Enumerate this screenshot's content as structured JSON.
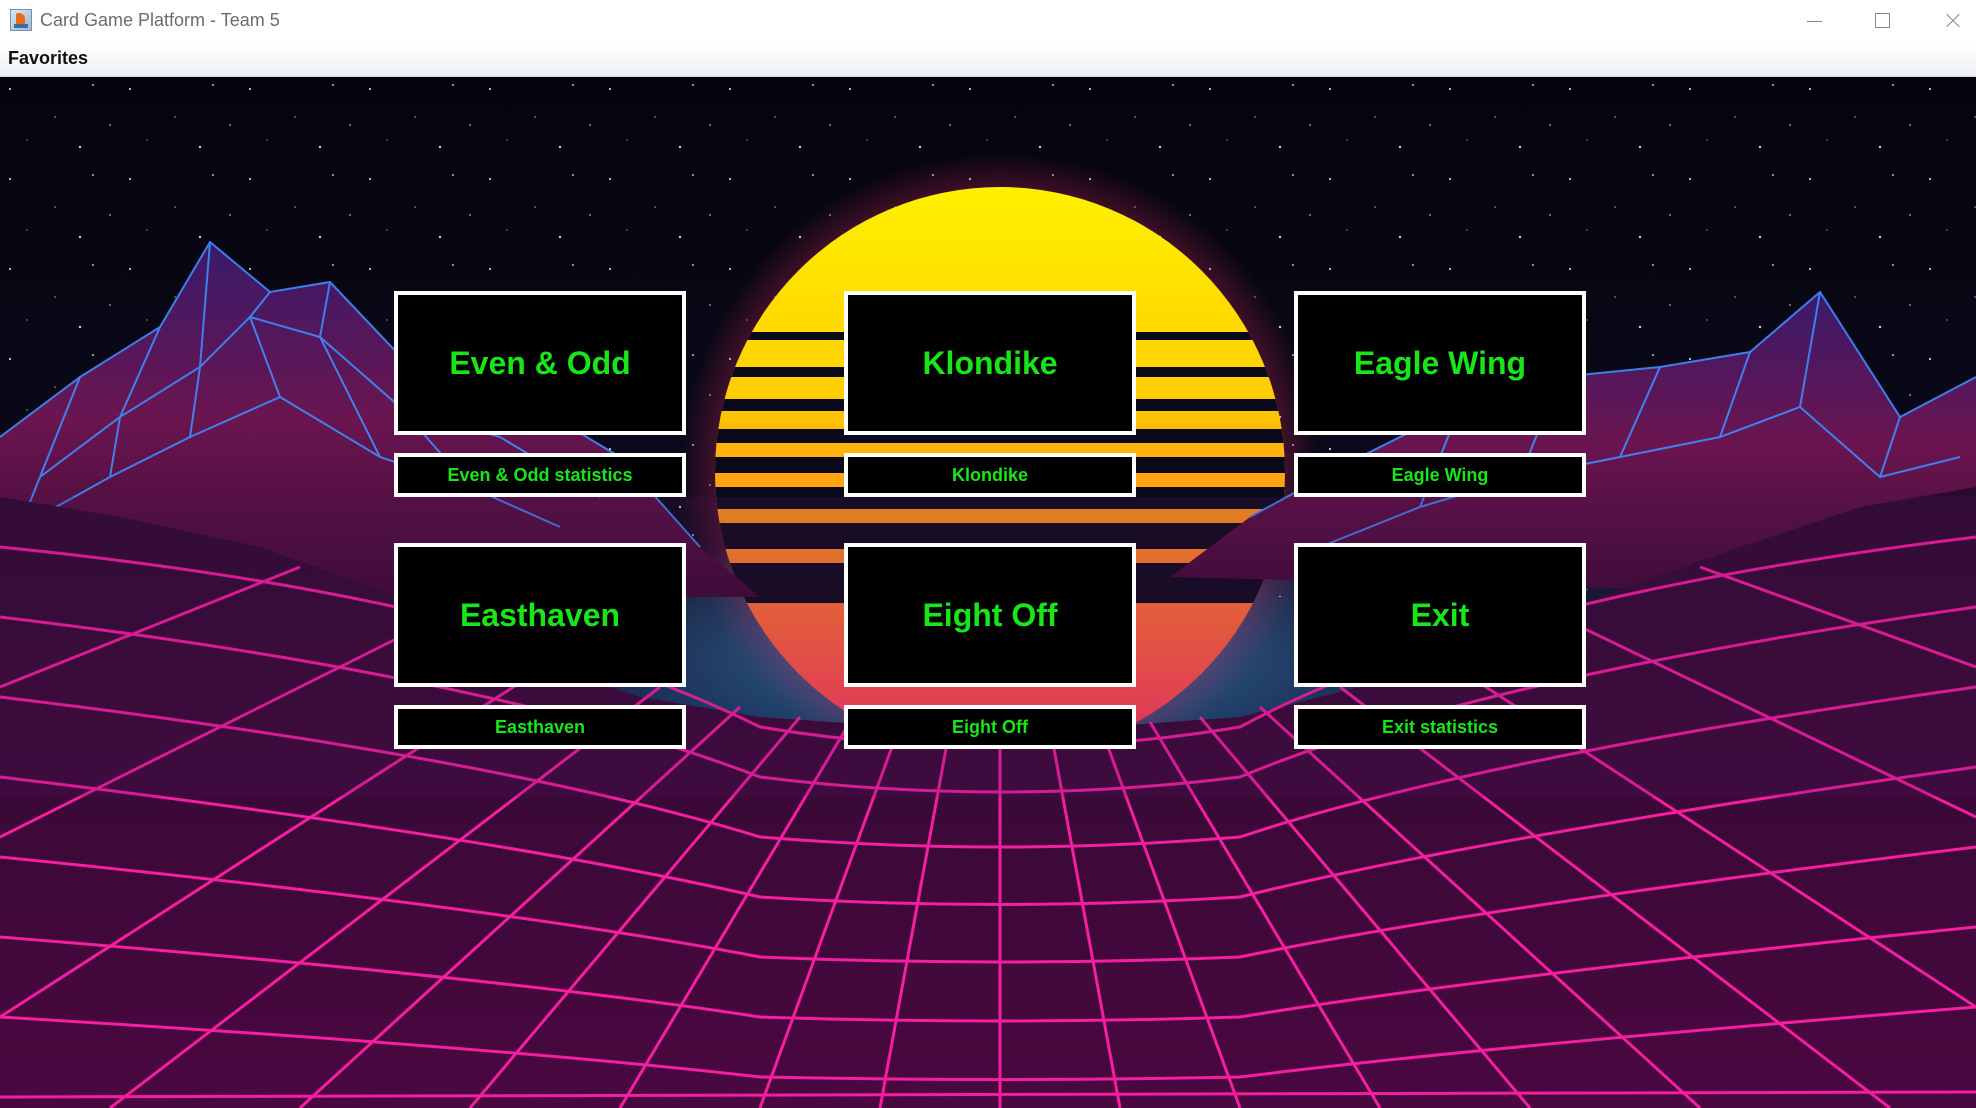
{
  "window": {
    "title": "Card Game Platform - Team 5"
  },
  "menubar": {
    "items": [
      {
        "label": "Favorites"
      }
    ]
  },
  "games": [
    {
      "label": "Even & Odd",
      "stats_label": "Even & Odd statistics"
    },
    {
      "label": "Klondike",
      "stats_label": "Klondike"
    },
    {
      "label": "Eagle Wing",
      "stats_label": "Eagle Wing"
    },
    {
      "label": "Easthaven",
      "stats_label": "Easthaven"
    },
    {
      "label": "Eight Off",
      "stats_label": "Eight Off"
    },
    {
      "label": "Exit",
      "stats_label": "Exit statistics"
    }
  ],
  "colors": {
    "button_text": "#19e619",
    "button_bg": "#000000",
    "button_border": "#ffffff",
    "grid_pink": "#ff1fa6",
    "grid_blue": "#3d8cff",
    "sun_top": "#fff200",
    "sun_bottom": "#ff2d6a"
  },
  "icons": {
    "app": "java-cup-icon",
    "minimize": "minimize-icon",
    "maximize": "maximize-icon",
    "close": "close-icon"
  }
}
